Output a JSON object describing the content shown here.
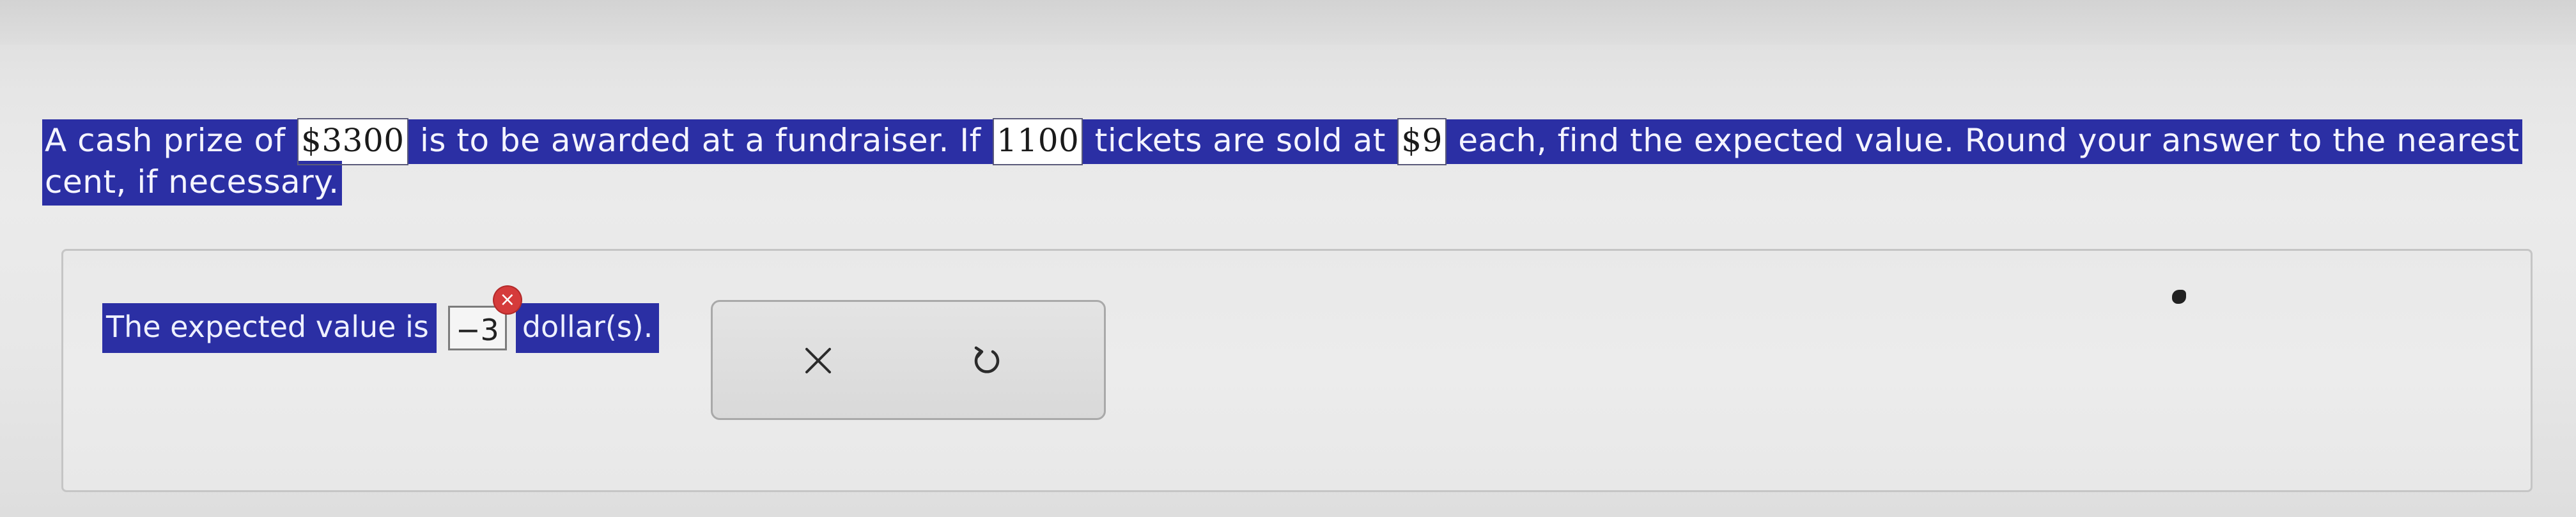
{
  "question": {
    "seg1": "A cash prize of ",
    "prize": "$3300",
    "seg2": " is to be awarded at a fundraiser. If ",
    "tickets": "1100",
    "seg3": " tickets are sold at ",
    "price": "$9",
    "seg4": " each, find the expected value. Round your answer to the nearest cent, if necessary."
  },
  "answer": {
    "prefix": "The expected value is",
    "value": "−3",
    "suffix": "dollar(s).",
    "error_mark": "×"
  },
  "actions": {
    "clear_icon": "close-icon",
    "reset_icon": "undo-icon"
  }
}
